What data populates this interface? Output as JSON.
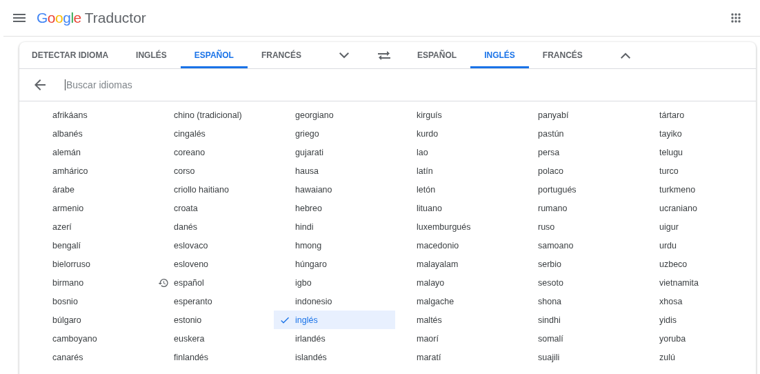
{
  "header": {
    "logo": "Google",
    "product": "Traductor"
  },
  "source_tabs": [
    {
      "label": "DETECTAR IDIOMA",
      "selected": false
    },
    {
      "label": "INGLÉS",
      "selected": false
    },
    {
      "label": "ESPAÑOL",
      "selected": true
    },
    {
      "label": "FRANCÉS",
      "selected": false
    }
  ],
  "target_tabs": [
    {
      "label": "ESPAÑOL",
      "selected": false
    },
    {
      "label": "INGLÉS",
      "selected": true
    },
    {
      "label": "FRANCÉS",
      "selected": false
    }
  ],
  "search": {
    "placeholder": "Buscar idiomas"
  },
  "languages": [
    [
      {
        "label": "afrikáans",
        "selected": false,
        "recent": false
      },
      {
        "label": "albanés",
        "selected": false,
        "recent": false
      },
      {
        "label": "alemán",
        "selected": false,
        "recent": false
      },
      {
        "label": "amhárico",
        "selected": false,
        "recent": false
      },
      {
        "label": "árabe",
        "selected": false,
        "recent": false
      },
      {
        "label": "armenio",
        "selected": false,
        "recent": false
      },
      {
        "label": "azerí",
        "selected": false,
        "recent": false
      },
      {
        "label": "bengalí",
        "selected": false,
        "recent": false
      },
      {
        "label": "bielorruso",
        "selected": false,
        "recent": false
      },
      {
        "label": "birmano",
        "selected": false,
        "recent": false
      },
      {
        "label": "bosnio",
        "selected": false,
        "recent": false
      },
      {
        "label": "búlgaro",
        "selected": false,
        "recent": false
      },
      {
        "label": "camboyano",
        "selected": false,
        "recent": false
      },
      {
        "label": "canarés",
        "selected": false,
        "recent": false
      }
    ],
    [
      {
        "label": "chino (tradicional)",
        "selected": false,
        "recent": false
      },
      {
        "label": "cingalés",
        "selected": false,
        "recent": false
      },
      {
        "label": "coreano",
        "selected": false,
        "recent": false
      },
      {
        "label": "corso",
        "selected": false,
        "recent": false
      },
      {
        "label": "criollo haitiano",
        "selected": false,
        "recent": false
      },
      {
        "label": "croata",
        "selected": false,
        "recent": false
      },
      {
        "label": "danés",
        "selected": false,
        "recent": false
      },
      {
        "label": "eslovaco",
        "selected": false,
        "recent": false
      },
      {
        "label": "esloveno",
        "selected": false,
        "recent": false
      },
      {
        "label": "español",
        "selected": false,
        "recent": true
      },
      {
        "label": "esperanto",
        "selected": false,
        "recent": false
      },
      {
        "label": "estonio",
        "selected": false,
        "recent": false
      },
      {
        "label": "euskera",
        "selected": false,
        "recent": false
      },
      {
        "label": "finlandés",
        "selected": false,
        "recent": false
      }
    ],
    [
      {
        "label": "georgiano",
        "selected": false,
        "recent": false
      },
      {
        "label": "griego",
        "selected": false,
        "recent": false
      },
      {
        "label": "gujarati",
        "selected": false,
        "recent": false
      },
      {
        "label": "hausa",
        "selected": false,
        "recent": false
      },
      {
        "label": "hawaiano",
        "selected": false,
        "recent": false
      },
      {
        "label": "hebreo",
        "selected": false,
        "recent": false
      },
      {
        "label": "hindi",
        "selected": false,
        "recent": false
      },
      {
        "label": "hmong",
        "selected": false,
        "recent": false
      },
      {
        "label": "húngaro",
        "selected": false,
        "recent": false
      },
      {
        "label": "igbo",
        "selected": false,
        "recent": false
      },
      {
        "label": "indonesio",
        "selected": false,
        "recent": false
      },
      {
        "label": "inglés",
        "selected": true,
        "recent": false
      },
      {
        "label": "irlandés",
        "selected": false,
        "recent": false
      },
      {
        "label": "islandés",
        "selected": false,
        "recent": false
      }
    ],
    [
      {
        "label": "kirguís",
        "selected": false,
        "recent": false
      },
      {
        "label": "kurdo",
        "selected": false,
        "recent": false
      },
      {
        "label": "lao",
        "selected": false,
        "recent": false
      },
      {
        "label": "latín",
        "selected": false,
        "recent": false
      },
      {
        "label": "letón",
        "selected": false,
        "recent": false
      },
      {
        "label": "lituano",
        "selected": false,
        "recent": false
      },
      {
        "label": "luxemburgués",
        "selected": false,
        "recent": false
      },
      {
        "label": "macedonio",
        "selected": false,
        "recent": false
      },
      {
        "label": "malayalam",
        "selected": false,
        "recent": false
      },
      {
        "label": "malayo",
        "selected": false,
        "recent": false
      },
      {
        "label": "malgache",
        "selected": false,
        "recent": false
      },
      {
        "label": "maltés",
        "selected": false,
        "recent": false
      },
      {
        "label": "maorí",
        "selected": false,
        "recent": false
      },
      {
        "label": "maratí",
        "selected": false,
        "recent": false
      }
    ],
    [
      {
        "label": "panyabí",
        "selected": false,
        "recent": false
      },
      {
        "label": "pastún",
        "selected": false,
        "recent": false
      },
      {
        "label": "persa",
        "selected": false,
        "recent": false
      },
      {
        "label": "polaco",
        "selected": false,
        "recent": false
      },
      {
        "label": "portugués",
        "selected": false,
        "recent": false
      },
      {
        "label": "rumano",
        "selected": false,
        "recent": false
      },
      {
        "label": "ruso",
        "selected": false,
        "recent": false
      },
      {
        "label": "samoano",
        "selected": false,
        "recent": false
      },
      {
        "label": "serbio",
        "selected": false,
        "recent": false
      },
      {
        "label": "sesoto",
        "selected": false,
        "recent": false
      },
      {
        "label": "shona",
        "selected": false,
        "recent": false
      },
      {
        "label": "sindhi",
        "selected": false,
        "recent": false
      },
      {
        "label": "somalí",
        "selected": false,
        "recent": false
      },
      {
        "label": "suajili",
        "selected": false,
        "recent": false
      }
    ],
    [
      {
        "label": "tártaro",
        "selected": false,
        "recent": false
      },
      {
        "label": "tayiko",
        "selected": false,
        "recent": false
      },
      {
        "label": "telugu",
        "selected": false,
        "recent": false
      },
      {
        "label": "turco",
        "selected": false,
        "recent": false
      },
      {
        "label": "turkmeno",
        "selected": false,
        "recent": false
      },
      {
        "label": "ucraniano",
        "selected": false,
        "recent": false
      },
      {
        "label": "uigur",
        "selected": false,
        "recent": false
      },
      {
        "label": "urdu",
        "selected": false,
        "recent": false
      },
      {
        "label": "uzbeco",
        "selected": false,
        "recent": false
      },
      {
        "label": "vietnamita",
        "selected": false,
        "recent": false
      },
      {
        "label": "xhosa",
        "selected": false,
        "recent": false
      },
      {
        "label": "yidis",
        "selected": false,
        "recent": false
      },
      {
        "label": "yoruba",
        "selected": false,
        "recent": false
      },
      {
        "label": "zulú",
        "selected": false,
        "recent": false
      }
    ]
  ]
}
